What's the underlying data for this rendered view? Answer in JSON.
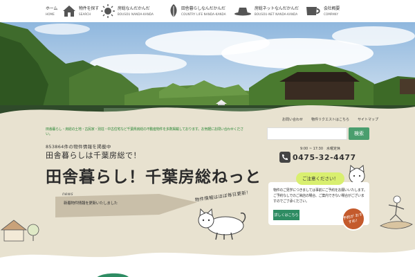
{
  "nav": {
    "items": [
      {
        "jp": "ホーム",
        "en": "HOME",
        "icon": "house-icon"
      },
      {
        "jp": "物件を探す",
        "en": "SEARCH",
        "icon": "house-icon"
      },
      {
        "jp": "房総なんだかんだ",
        "en": "BOUSOU NANDA-KANDA",
        "icon": "sun-icon"
      },
      {
        "jp": "田舎暮らしなんだかんだ",
        "en": "COUNTRY LIFE NANDA-KANDA",
        "icon": "leaf-icon"
      },
      {
        "jp": "房総ネットなんだかんだ",
        "en": "BOUSOU-NET NANDA-KANDA",
        "icon": "hat-icon"
      },
      {
        "jp": "会社概要",
        "en": "COMPANY",
        "icon": "cup-icon"
      }
    ]
  },
  "hero": {
    "lead": "田舎暮らし・房総の土地・古民家・別荘・中古住宅など千葉県房総の不動産物件を多数掲載しております。お気軽にお問い合わせください。",
    "zip": "853864件の物件情報を掲載中",
    "tagline": "田舎暮らしは千葉房総で！",
    "logo": "田舎暮らし！千葉房総ねっと",
    "news_label": "news",
    "news_text": "新着物件情報を更新いたしました",
    "updated": "物件情報はほぼ毎日更新！"
  },
  "sidebar": {
    "mini_links": [
      "お問い合わせ",
      "物件リクエストはこちら",
      "サイトマップ"
    ],
    "search_placeholder": "",
    "search_button": "検索",
    "hours": "9:00 ~ 17:30　水曜定休",
    "phone": "0475-32-4477",
    "notice": "ご注意ください！",
    "info_text": "物件のご見学につきましては事前にご予約をお願いいたします。ご予約なしでのご来店の場合、ご案内できない場合がございますのでご了承ください。",
    "detail_button": "詳しくはこちら",
    "recommend": "予約が おすすめ！"
  },
  "colors": {
    "green": "#2f8a3a",
    "button_green": "#4a9e6e",
    "notice_yellow": "#d9ef6f",
    "stamp_red": "#c45a2c",
    "paper": "#e8e2d0"
  }
}
